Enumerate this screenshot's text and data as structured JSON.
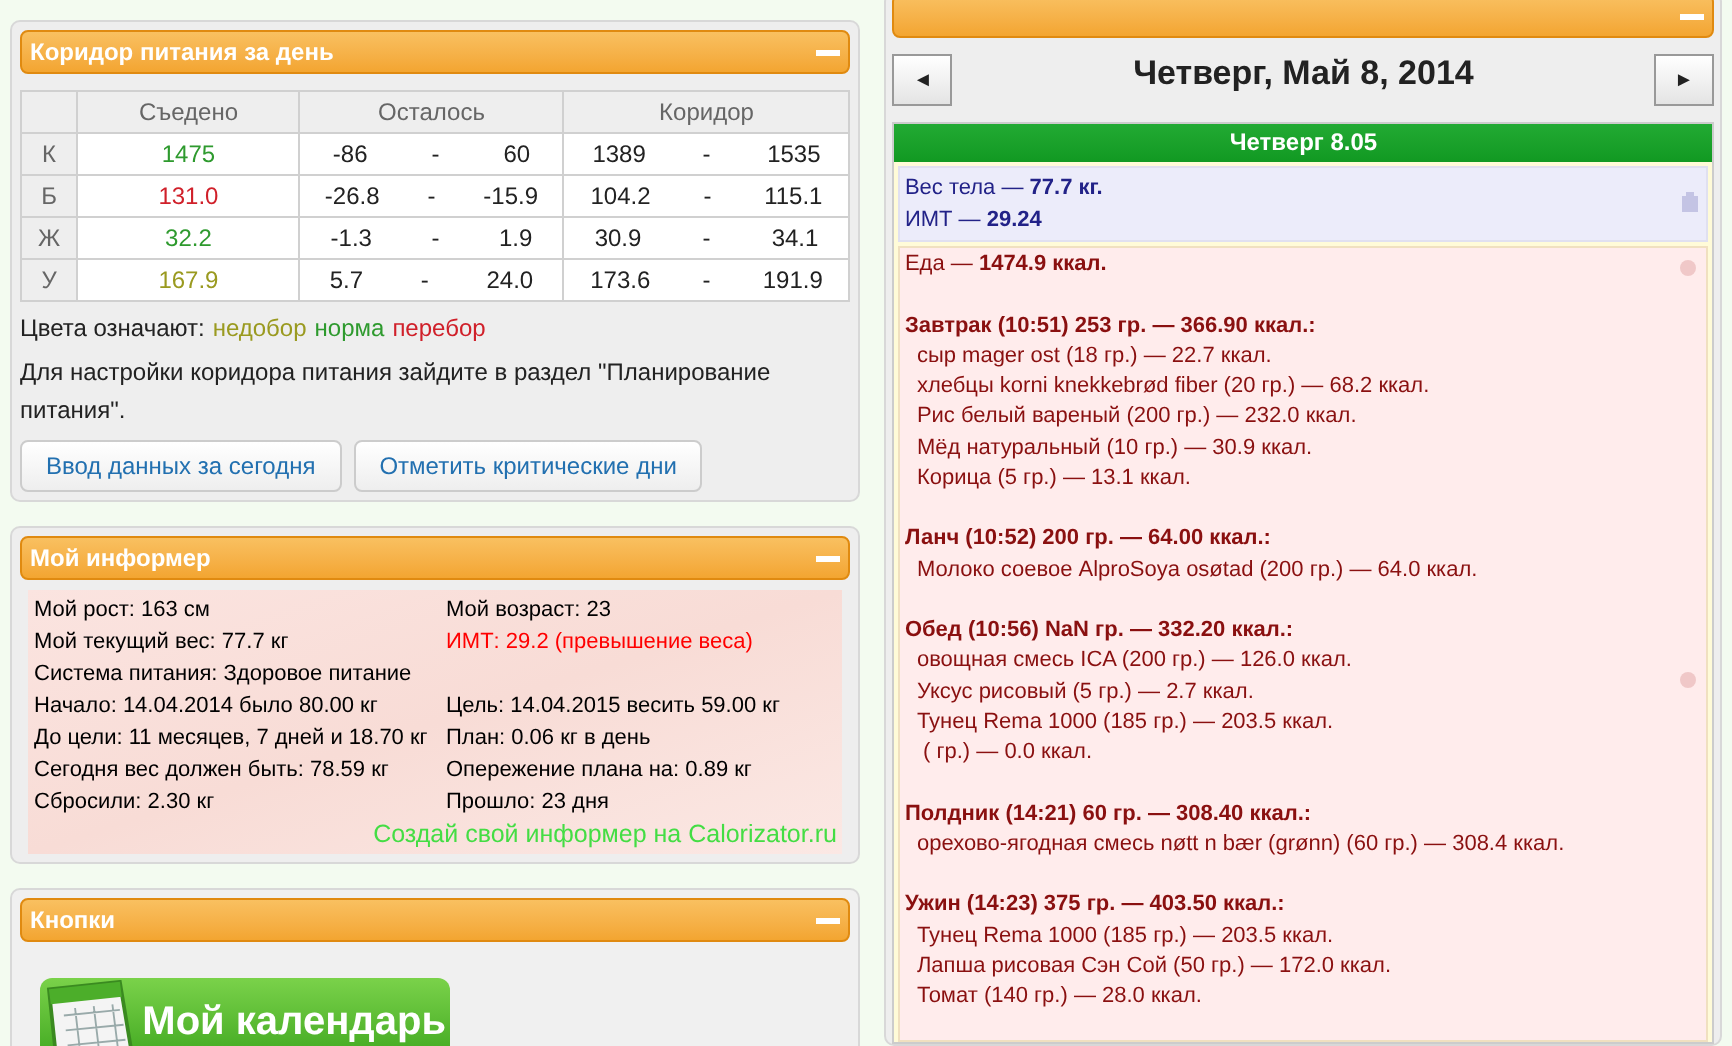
{
  "corridor": {
    "title": "Коридор питания за день",
    "columns": [
      "Съедено",
      "Осталось",
      "Коридор"
    ],
    "rows": [
      {
        "label": "К",
        "eaten": "1475",
        "color": "#2e9a2e",
        "left_min": "-86",
        "left_max": "60",
        "range_min": "1389",
        "range_max": "1535"
      },
      {
        "label": "Б",
        "eaten": "131.0",
        "color": "#d0202a",
        "left_min": "-26.8",
        "left_max": "-15.9",
        "range_min": "104.2",
        "range_max": "115.1"
      },
      {
        "label": "Ж",
        "eaten": "32.2",
        "color": "#2e9a2e",
        "left_min": "-1.3",
        "left_max": "1.9",
        "range_min": "30.9",
        "range_max": "34.1"
      },
      {
        "label": "У",
        "eaten": "167.9",
        "color": "#9a9a20",
        "left_min": "5.7",
        "left_max": "24.0",
        "range_min": "173.6",
        "range_max": "191.9"
      }
    ],
    "separator": "-",
    "legend_label": "Цвета означают:",
    "legend": [
      {
        "text": "недобор",
        "color": "#9a9a20"
      },
      {
        "text": "норма",
        "color": "#2e9a2e"
      },
      {
        "text": "перебор",
        "color": "#d0202a"
      }
    ],
    "note": "Для настройки коридора питания зайдите в раздел \"Планирование питания\".",
    "buttons": [
      "Ввод данных за сегодня",
      "Отметить критические дни"
    ]
  },
  "informer": {
    "title": "Мой информер",
    "rows": [
      {
        "left": "Мой рост: 163 см",
        "right": "Мой возраст: 23",
        "right_alert": false
      },
      {
        "left": "Мой текущий вес: 77.7 кг",
        "right": "ИМТ: 29.2 (превышение веса)",
        "right_alert": true
      },
      {
        "left": "Система питания: Здоровое питание"
      },
      {
        "left": "Начало: 14.04.2014 было 80.00 кг",
        "right": "Цель: 14.04.2015 весить 59.00 кг",
        "right_alert": false
      },
      {
        "left": "До цели: 11 месяцев, 7 дней и 18.70 кг",
        "right": "План: 0.06 кг в день",
        "right_alert": false
      },
      {
        "left": "Сегодня вес должен быть: 78.59 кг",
        "right": "Опережение плана на: 0.89 кг",
        "right_alert": false
      },
      {
        "left": "Сбросили: 2.30 кг",
        "right": "Прошло: 23 дня",
        "right_alert": false
      }
    ],
    "link": "Создай свой информер на Calorizator.ru"
  },
  "buttons_panel": {
    "title": "Кнопки",
    "calendar_button": "Мой календарь"
  },
  "calendar": {
    "prev": "◄",
    "next": "►",
    "date": "Четверг, Май 8, 2014",
    "day_header": "Четверг 8.05",
    "body": [
      "Вес тела — **77.7 кг.**",
      "ИМТ — **29.24**"
    ],
    "food_total": "Еда — **1474.9 ккал.**",
    "meals": [
      {
        "title": "Завтрак (10:51) 253 гр. — 366.90 ккал.:",
        "items": [
          "сыр mager ost (18 гр.) — 22.7 ккал.",
          "хлебцы korni knekkebrød fiber (20 гр.) — 68.2 ккал.",
          "Рис белый вареный (200 гр.) — 232.0 ккал.",
          "Мёд натуральный (10 гр.) — 30.9 ккал.",
          "Корица (5 гр.) — 13.1 ккал."
        ]
      },
      {
        "title": "Ланч (10:52) 200 гр. — 64.00 ккал.:",
        "items": [
          "Молоко соевое AlproSoya osøtad (200 гр.) — 64.0 ккал."
        ]
      },
      {
        "title": "Обед (10:56) NaN гр. — 332.20 ккал.:",
        "items": [
          "овощная смесь ICA (200 гр.) — 126.0 ккал.",
          "Уксус рисовый (5 гр.) — 2.7 ккал.",
          "Тунец Rema 1000 (185 гр.) — 203.5 ккал.",
          " ( гр.) — 0.0 ккал."
        ]
      },
      {
        "title": "Полдник (14:21) 60 гр. — 308.40 ккал.:",
        "items": [
          "орехово-ягодная смесь nøtt n bær (grønn) (60 гр.) — 308.4 ккал."
        ]
      },
      {
        "title": "Ужин (14:23) 375 гр. — 403.50 ккал.:",
        "items": [
          "Тунец Rema 1000 (185 гр.) — 203.5 ккал.",
          "Лапша рисовая Сэн Сой (50 гр.) — 172.0 ккал.",
          "Томат (140 гр.) — 28.0 ккал."
        ]
      }
    ]
  }
}
